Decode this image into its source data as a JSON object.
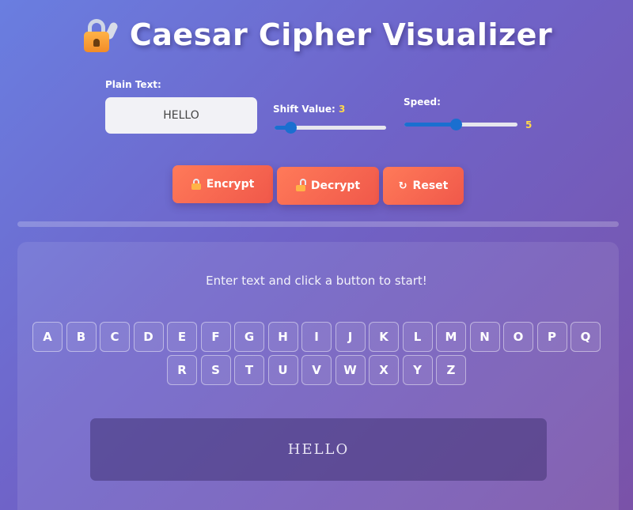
{
  "title": "Caesar Cipher Visualizer",
  "plain_text": {
    "label": "Plain Text:",
    "value": "HELLO"
  },
  "shift": {
    "label": "Shift Value:",
    "value": "3",
    "slider_fraction": 0.1
  },
  "speed": {
    "label": "Speed:",
    "value": "5",
    "slider_fraction": 0.45
  },
  "buttons": {
    "encrypt": "Encrypt",
    "decrypt": "Decrypt",
    "reset": "Reset",
    "reset_icon": "↻"
  },
  "status": "Enter text and click a button to start!",
  "alphabet_row1": [
    "A",
    "B",
    "C",
    "D",
    "E",
    "F",
    "G",
    "H",
    "I",
    "J",
    "K",
    "L",
    "M",
    "N",
    "O",
    "P",
    "Q"
  ],
  "alphabet_row2": [
    "R",
    "S",
    "T",
    "U",
    "V",
    "W",
    "X",
    "Y",
    "Z"
  ],
  "output": "HELLO",
  "colors": {
    "accent": "#f0584a",
    "slider": "#1a6fd0",
    "highlight": "#ffd84a"
  },
  "icons": {
    "title": "lock-with-key-icon",
    "encrypt": "lock-icon",
    "decrypt": "unlock-icon",
    "reset": "refresh-icon"
  }
}
